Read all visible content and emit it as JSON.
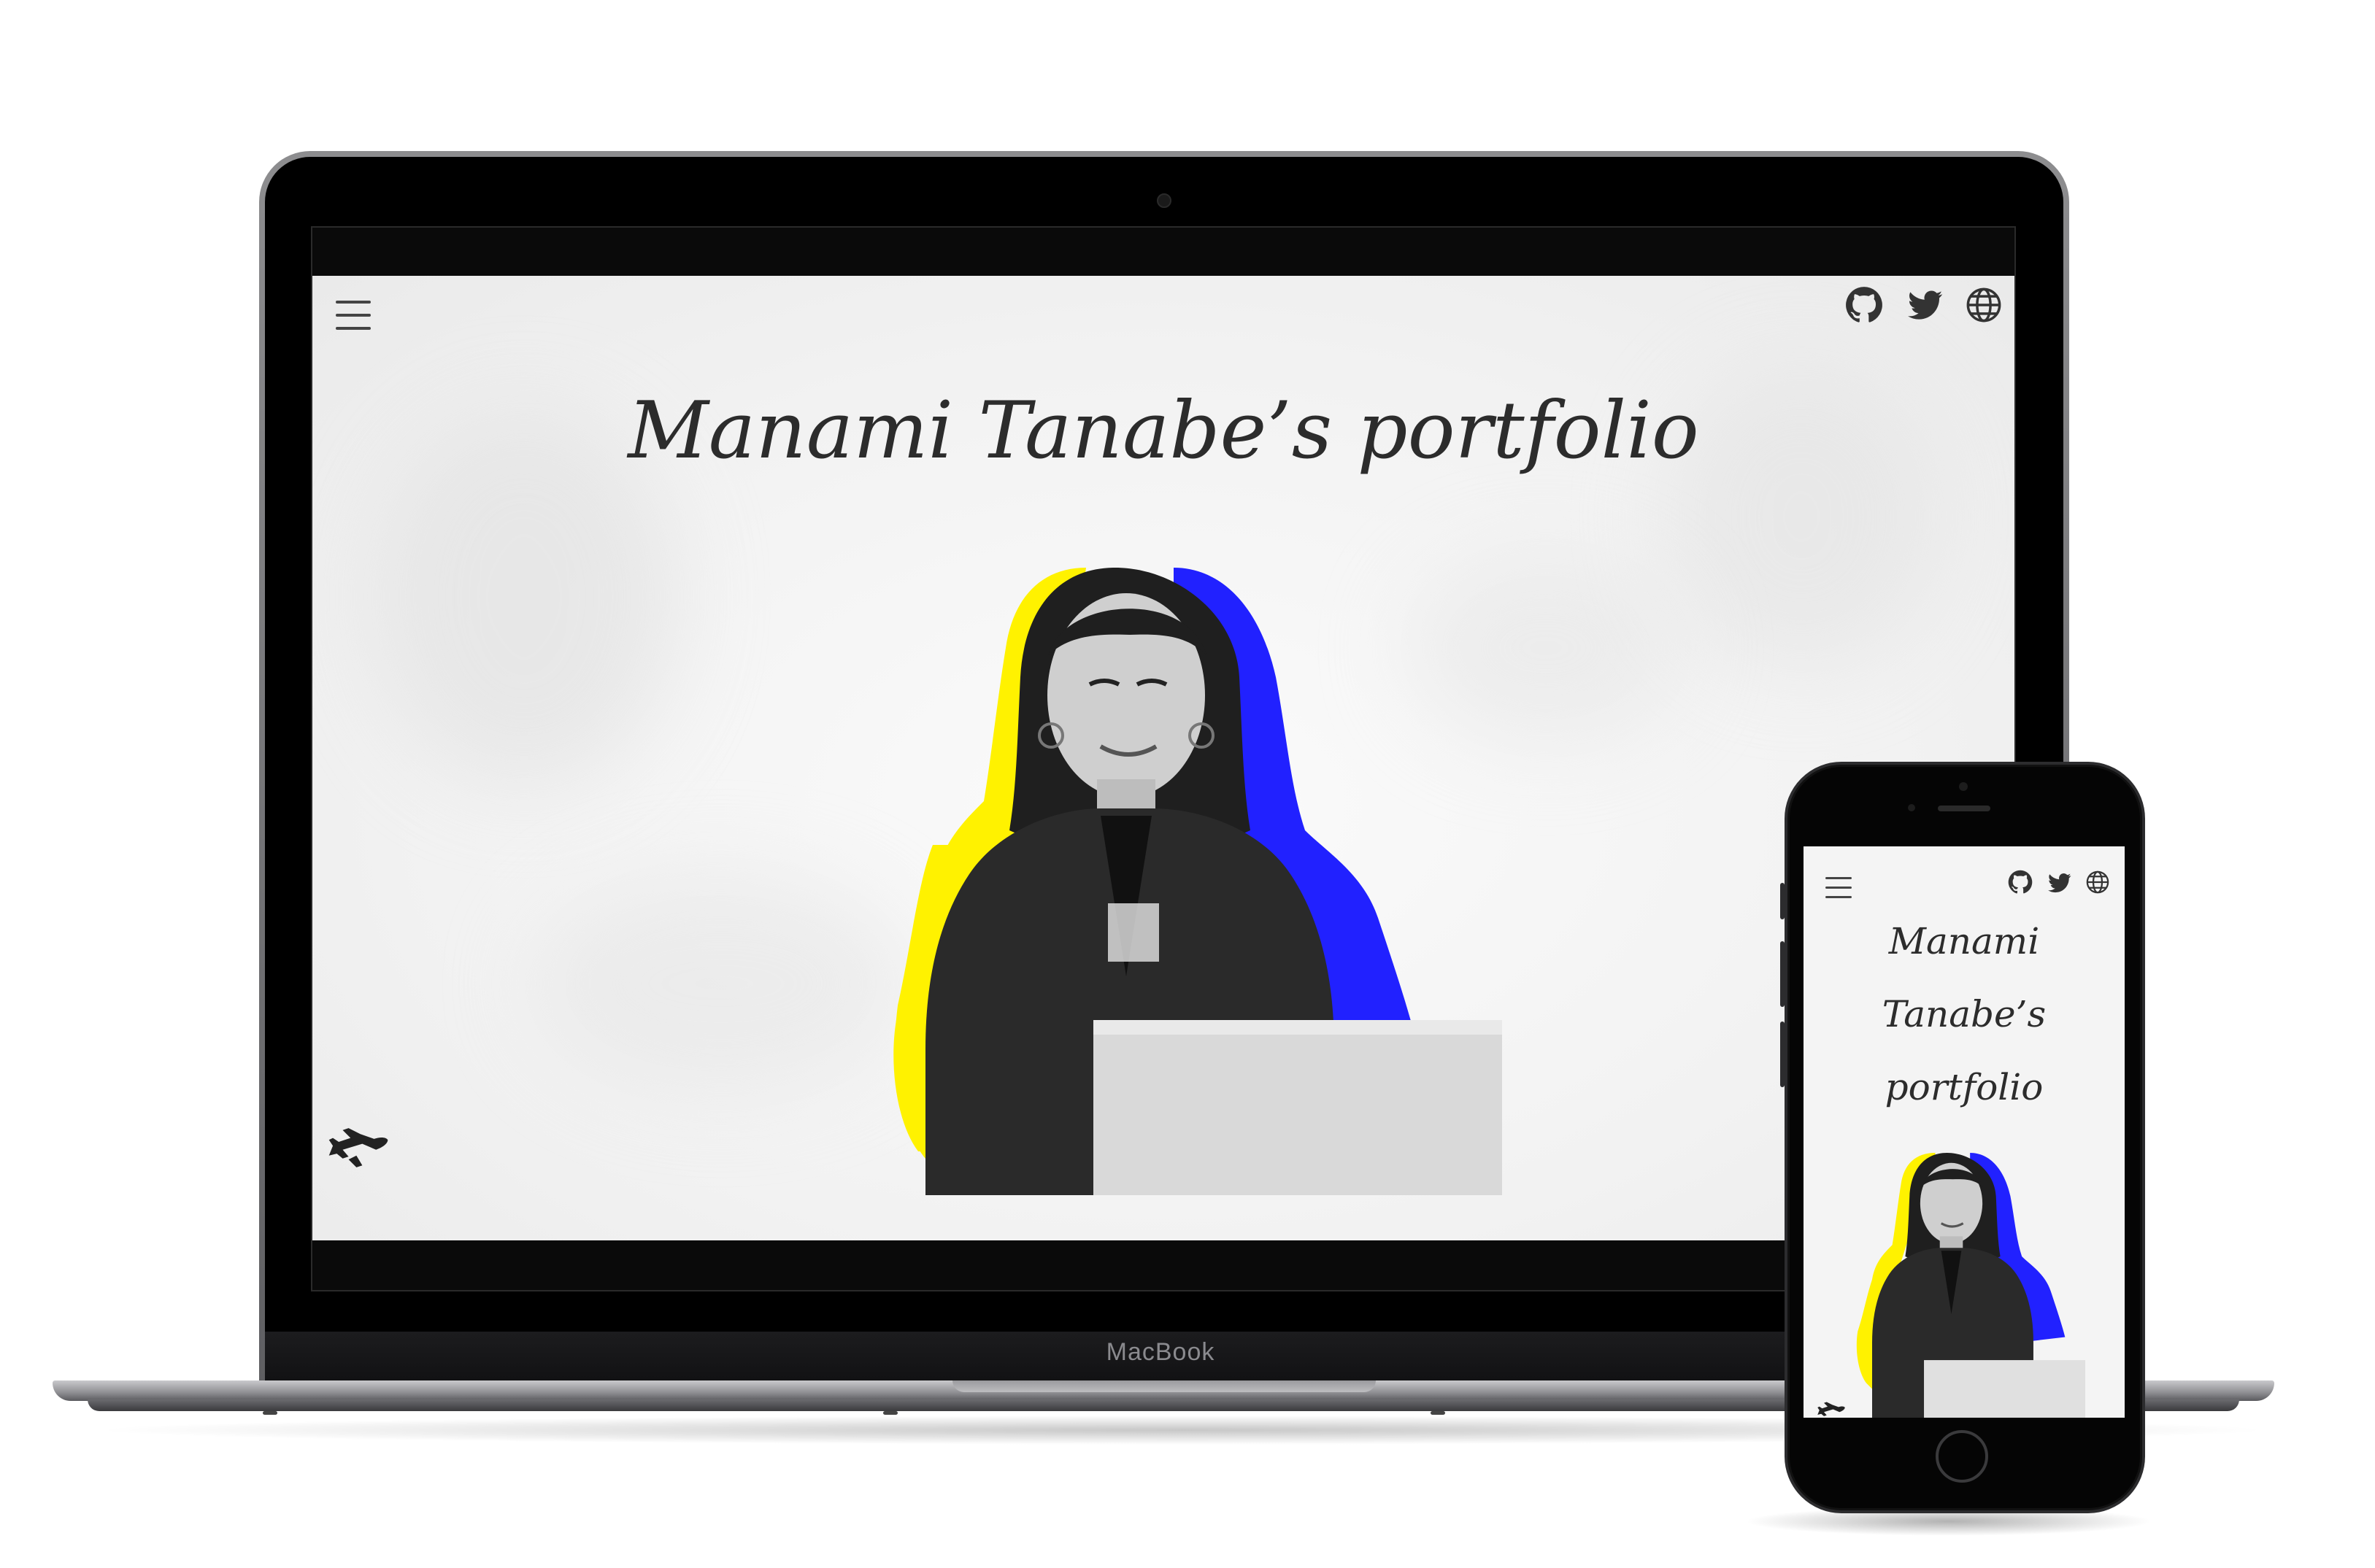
{
  "device_labels": {
    "laptop_brand": "MacBook"
  },
  "site": {
    "title": "Manami Tanabe’s portfolio",
    "mobile_title_lines": [
      "Manami",
      "Tanabe’s",
      "portfolio"
    ],
    "nav": {
      "menu_icon": "hamburger-menu-icon",
      "social_icons": [
        "github-icon",
        "twitter-icon",
        "globe-icon"
      ],
      "corner_icon": "airplane-icon"
    },
    "accent_colors": {
      "yellow": "#fff200",
      "blue": "#2121ff",
      "text": "#2c2c2c",
      "background": "#f4f4f4"
    }
  }
}
